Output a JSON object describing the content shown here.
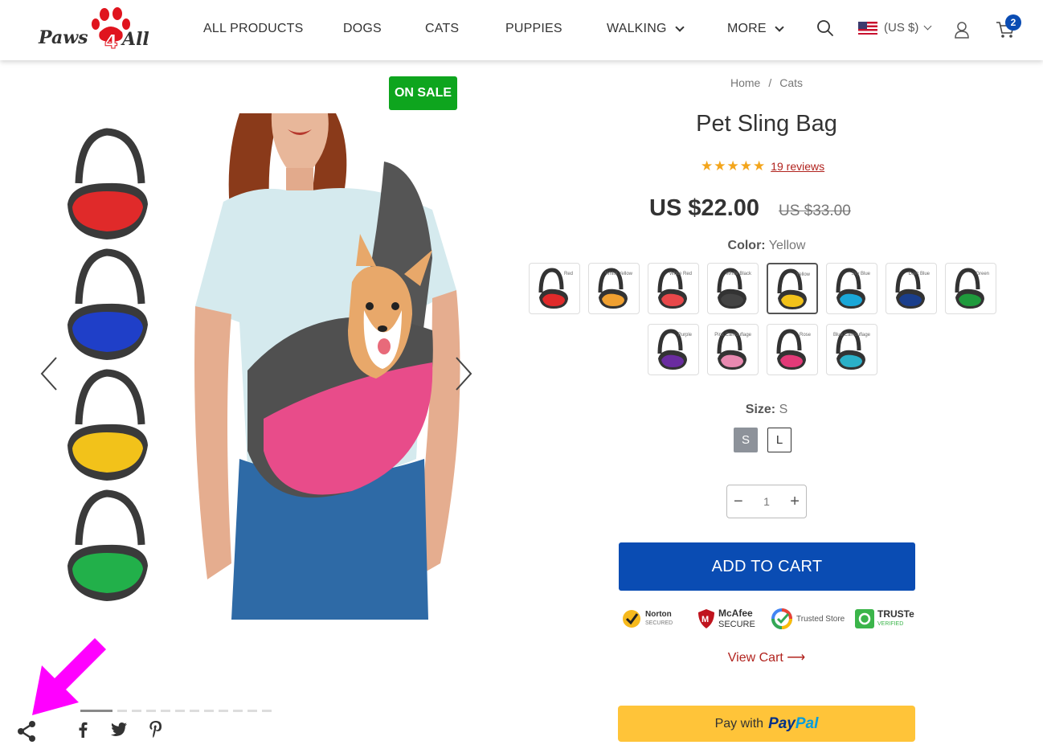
{
  "header": {
    "logo_text": "Paws4All",
    "nav": [
      {
        "label": "ALL PRODUCTS"
      },
      {
        "label": "DOGS"
      },
      {
        "label": "CATS"
      },
      {
        "label": "PUPPIES"
      },
      {
        "label": "WALKING"
      },
      {
        "label": "MORE"
      }
    ],
    "currency": "(US $)",
    "cart_count": "2"
  },
  "gallery": {
    "sale_badge": "ON SALE",
    "thumbnails": [
      "red",
      "blue",
      "yellow",
      "green"
    ],
    "active_slide": 1,
    "total_slides": 13
  },
  "product": {
    "breadcrumb": {
      "home": "Home",
      "sep": "/",
      "category": "Cats"
    },
    "title": "Pet Sling Bag",
    "rating": 5,
    "reviews": "19 reviews",
    "price": "US $22.00",
    "old_price": "US $33.00",
    "color_label": "Color:",
    "color_value": "Yellow",
    "colors": [
      {
        "name": "Red",
        "hex": "#e02a2a"
      },
      {
        "name": "White Yellow",
        "hex": "#f0a030"
      },
      {
        "name": "White Red",
        "hex": "#e8484a"
      },
      {
        "name": "White Black",
        "hex": "#444444"
      },
      {
        "name": "Yellow",
        "hex": "#f2c21a"
      },
      {
        "name": "Sky Blue",
        "hex": "#1aa7d8"
      },
      {
        "name": "Dark Blue",
        "hex": "#1a3e8c"
      },
      {
        "name": "Green",
        "hex": "#1f9a3c"
      },
      {
        "name": "Purple",
        "hex": "#6a2ca0"
      },
      {
        "name": "Pink Camouflage",
        "hex": "#e889b0"
      },
      {
        "name": "Rose",
        "hex": "#e23a78"
      },
      {
        "name": "Blue Camouflage",
        "hex": "#2ab0c8"
      }
    ],
    "size_label": "Size:",
    "size_value": "S",
    "sizes": [
      "S",
      "L"
    ],
    "quantity": "1",
    "add_to_cart": "ADD TO CART",
    "view_cart": "View Cart ⟶",
    "paypal_prefix": "Pay with",
    "paypal_brand_1": "Pay",
    "paypal_brand_2": "Pal"
  },
  "trust": {
    "norton": "Norton",
    "norton_sub": "SECURED",
    "mcafee": "McAfee",
    "mcafee_sub": "SECURE",
    "trusted": "Trusted Store",
    "truste": "TRUSTe",
    "truste_sub": "VERIFIED"
  },
  "colors": {
    "accent": "#0a4cb3",
    "sale": "#0ea51e",
    "star": "#f3a51b",
    "link": "#b1231e",
    "paypal": "#ffc439",
    "annotation": "#ff00ff"
  }
}
